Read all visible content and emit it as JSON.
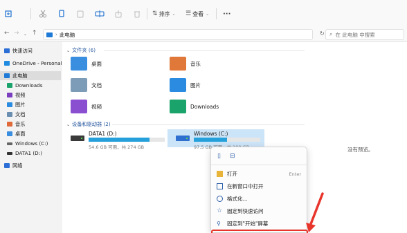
{
  "toolbar": {
    "sort_label": "排序",
    "view_label": "查看",
    "more_label": "···"
  },
  "address": {
    "path": "此电脑",
    "search_placeholder": "在 此电脑 中搜索"
  },
  "sidebar": {
    "items": [
      {
        "label": "快速访问",
        "color": "#2b6fd6"
      },
      {
        "label": "OneDrive - Personal",
        "color": "#1f8ae0"
      },
      {
        "label": "此电脑",
        "color": "#1e7ad6"
      },
      {
        "label": "Downloads",
        "color": "#1aa36a"
      },
      {
        "label": "视频",
        "color": "#7a3fbf"
      },
      {
        "label": "图片",
        "color": "#2a8be0"
      },
      {
        "label": "文档",
        "color": "#6a8fb0"
      },
      {
        "label": "音乐",
        "color": "#e06a3a"
      },
      {
        "label": "桌面",
        "color": "#3a8ee0"
      },
      {
        "label": "Windows (C:)",
        "color": "#666666"
      },
      {
        "label": "DATA1 (D:)",
        "color": "#333333"
      },
      {
        "label": "网络",
        "color": "#2b6fd6"
      }
    ]
  },
  "main": {
    "folders_header": "文件夹 (6)",
    "folders": [
      {
        "label": "桌面",
        "color": "#3a8ee0"
      },
      {
        "label": "音乐",
        "color": "#e0783a"
      },
      {
        "label": "文档",
        "color": "#7d9cb8"
      },
      {
        "label": "图片",
        "color": "#2a8be0"
      },
      {
        "label": "视频",
        "color": "#8a4fd0"
      },
      {
        "label": "Downloads",
        "color": "#1aa36a"
      }
    ],
    "drives_header": "设备和驱动器 (2)",
    "drives": [
      {
        "name": "DATA1 (D:)",
        "size": "54.6 GB 可用，共 274 GB",
        "used_fraction": 0.8
      },
      {
        "name": "Windows (C:)",
        "size": "97.5 GB 可用，共 199 GB",
        "used_fraction": 0.5
      }
    ],
    "no_preview": "没有预览。"
  },
  "context_menu": {
    "items": [
      {
        "label": "打开",
        "shortcut": "Enter"
      },
      {
        "label": "在新窗口中打开",
        "shortcut": ""
      },
      {
        "label": "格式化...",
        "shortcut": ""
      },
      {
        "label": "固定到快速访问",
        "shortcut": ""
      },
      {
        "label": "固定到\"开始\"屏幕",
        "shortcut": ""
      }
    ]
  },
  "colors": {
    "accent": "#26a0da",
    "highlight": "#e8352b"
  }
}
